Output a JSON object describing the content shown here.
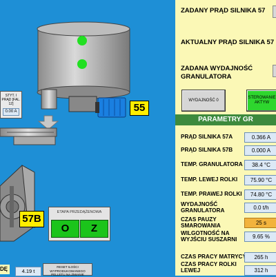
{
  "header_rows": [
    {
      "label": "ZADANY PRĄD SILNIKA 57"
    },
    {
      "label": "AKTUALNY PRĄD SILNIKA 57"
    },
    {
      "label": "ZADANA WYDAJNOŚĆ GRANULATORA"
    }
  ],
  "buttons": {
    "wydajnosc": "WYDAJNOŚĆ 0",
    "sterowanie": "STEROWANIE AKTYW"
  },
  "section_title": "PARAMETRY GR",
  "params": [
    {
      "label": "PRĄD SILNIKA 57A",
      "value": "0.366 A"
    },
    {
      "label": "PRĄD SILNIKA 57B",
      "value": "0.000 A"
    },
    {
      "label": "TEMP. GRANULATORA",
      "value": "38.4 °C"
    },
    {
      "label": "TEMP. LEWEJ ROLKI",
      "value": "75.90 °C"
    },
    {
      "label": "TEMP. PRAWEJ ROLKI",
      "value": "74.80 °C"
    },
    {
      "label": "WYDAJNOŚĆ GRANULATORA",
      "value": "0.0 t/h"
    },
    {
      "label": "CZAS PAUZY SMAROWANIA",
      "value": "25  s"
    },
    {
      "label": "WILGOTNOŚĆ NA WYJŚCIU SUSZARNI",
      "value": "9.65 %"
    },
    {
      "label": "CZAS PRACY MATRYCY",
      "value": "265 h"
    },
    {
      "label": "CZAS PRACY ROLKI LEWEJ",
      "value": "312 h"
    }
  ],
  "left": {
    "motor_55": "55",
    "label_57b": "57B",
    "small_panel_text": "STYT. I PRĄD [FAL. 12]",
    "small_panel_value": "0.00 A",
    "etapa_title": "ETAPA PRZEDĄŻENOWA",
    "etapa_o": "O",
    "etapa_z": "Z",
    "bottom_label": "DĘ",
    "bottom_value": "4.19 t",
    "reset_btn": "RESET ILOŚCI WYPRODUKOWANEGO PELLETU NA ZMIANIE"
  },
  "colors": {
    "background": "#1e8fd6",
    "panel": "#fbf8b6",
    "section": "#3d8a3d",
    "motor": "#1a7fe0",
    "label_yellow": "#ffee00"
  }
}
